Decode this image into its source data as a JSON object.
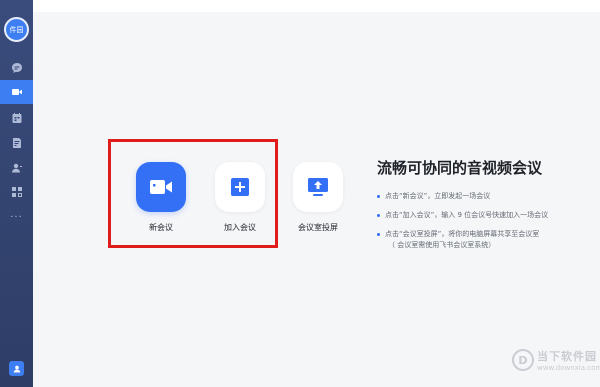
{
  "sidebar": {
    "avatar_text": "件园",
    "items": [
      {
        "icon": "chat-icon"
      },
      {
        "icon": "video-icon",
        "active": true
      },
      {
        "icon": "calendar-icon"
      },
      {
        "icon": "document-icon"
      },
      {
        "icon": "contacts-icon"
      },
      {
        "icon": "apps-icon"
      },
      {
        "icon": "more-icon",
        "label": "···"
      }
    ],
    "bottom_icon": "profile-icon"
  },
  "actions": [
    {
      "label": "新会议",
      "icon": "camera-icon"
    },
    {
      "label": "加入会议",
      "icon": "plus-icon"
    },
    {
      "label": "会议室投屏",
      "icon": "screen-share-icon"
    }
  ],
  "info": {
    "title": "流畅可协同的音视频会议",
    "tips": [
      {
        "text": "点击“新会议”，立即发起一场会议"
      },
      {
        "text": "点击“加入会议”，输入 9 位会议号快速加入一场会议"
      },
      {
        "text": "点击“会议室投屏”，将你的电脑屏幕共享至会议室",
        "sub": "（ 会议室需使用飞书会议室系统）"
      }
    ]
  },
  "watermark": {
    "name": "当下软件园",
    "url": "www.downxia.com"
  },
  "colors": {
    "accent": "#3370f5",
    "sidebar": "#34467a",
    "highlight": "#e01d1d"
  }
}
